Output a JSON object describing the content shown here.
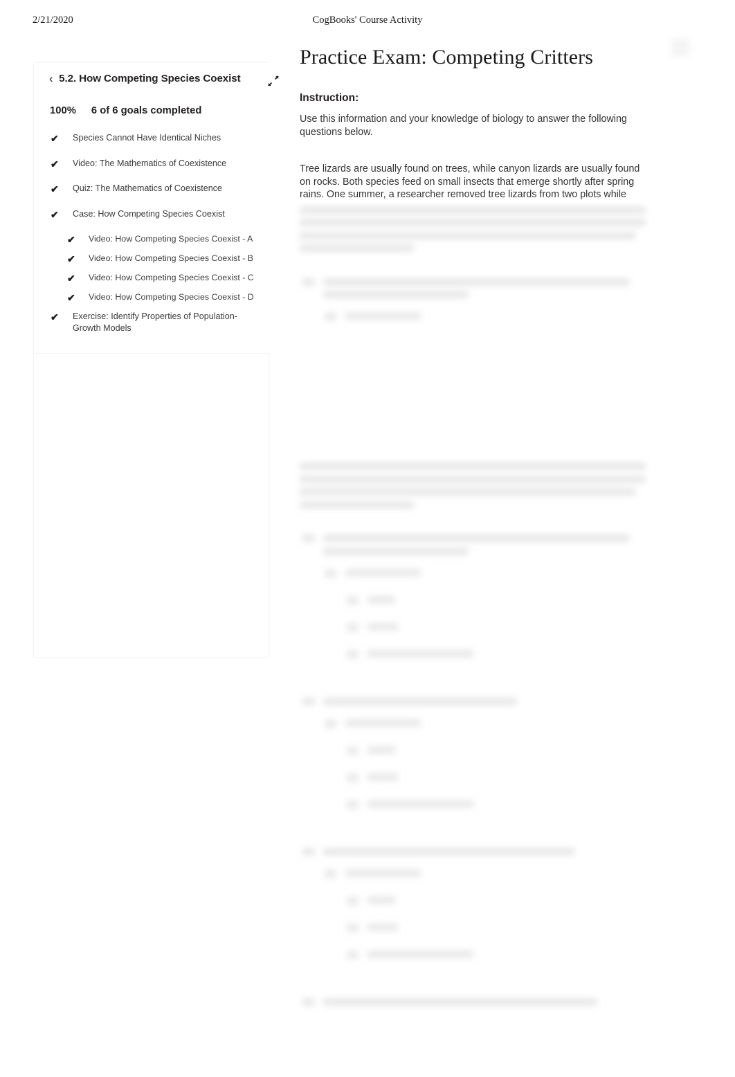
{
  "print_header": {
    "date": "2/21/2020",
    "site_title": "CogBooks' Course Activity"
  },
  "sidebar": {
    "back_chevron": "‹",
    "unit_title": "5.2. How Competing Species Coexist",
    "collapse_icon": "collapse-diagonal-arrows-icon",
    "progress_percent": "100%",
    "progress_label": "6 of 6 goals completed",
    "check_glyph": "✔",
    "goals": [
      {
        "label": "Species Cannot Have Identical Niches",
        "level": 0,
        "completed": true
      },
      {
        "label": "Video: The Mathematics of Coexistence",
        "level": 0,
        "completed": true
      },
      {
        "label": "Quiz: The Mathematics of Coexistence",
        "level": 0,
        "completed": true
      },
      {
        "label": "Case: How Competing Species Coexist",
        "level": 0,
        "completed": true
      },
      {
        "label": "Video: How Competing Species Coexist - A",
        "level": 1,
        "completed": true
      },
      {
        "label": "Video: How Competing Species Coexist - B",
        "level": 1,
        "completed": true
      },
      {
        "label": "Video: How Competing Species Coexist - C",
        "level": 1,
        "completed": true
      },
      {
        "label": "Video: How Competing Species Coexist - D",
        "level": 1,
        "completed": true
      },
      {
        "label": "Exercise: Identify Properties of Population-Growth Models",
        "level": 0,
        "completed": true
      }
    ]
  },
  "main": {
    "exam_title": "Practice Exam: Competing Critters",
    "instruction_heading": "Instruction:",
    "instruction_body": "Use this information and your knowledge of biology to answer the following questions below.",
    "passage_visible": "Tree lizards are usually found on trees, while canyon lizards are usually found on rocks. Both species feed on small insects that emerge shortly after spring rains. One summer, a researcher removed tree lizards from two plots while"
  }
}
